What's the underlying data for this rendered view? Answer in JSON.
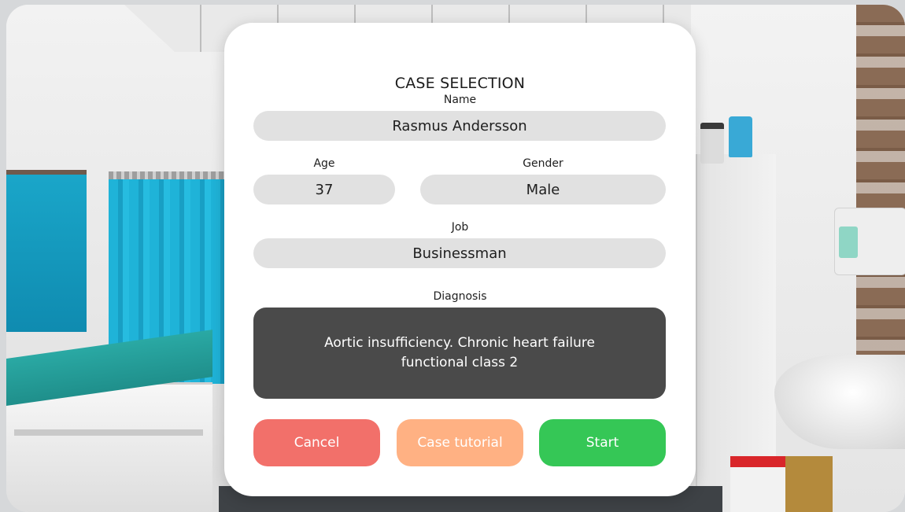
{
  "dialog": {
    "title": "CASE SELECTION",
    "name_label": "Name",
    "name_value": "Rasmus Andersson",
    "age_label": "Age",
    "age_value": "37",
    "gender_label": "Gender",
    "gender_value": "Male",
    "job_label": "Job",
    "job_value": "Businessman",
    "diagnosis_label": "Diagnosis",
    "diagnosis_text": "Aortic insufficiency. Chronic heart failure functional class 2"
  },
  "buttons": {
    "cancel_label": "Cancel",
    "tutorial_label": "Case tutorial",
    "start_label": "Start"
  },
  "colors": {
    "cancel": "#f2706a",
    "tutorial": "#ffb183",
    "start": "#35c756",
    "field_bg": "#e1e1e1",
    "diagnosis_bg": "#4a4a4a"
  }
}
